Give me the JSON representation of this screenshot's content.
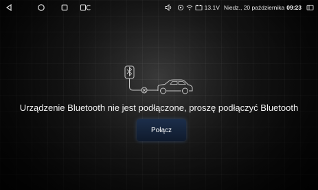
{
  "status_bar": {
    "voltage": "13.1V",
    "date": "Niedz., 20 października",
    "time": "09:23"
  },
  "icons": {
    "back": "back-triangle-icon",
    "home": "home-circle-icon",
    "recents": "recents-square-icon",
    "screen": "screen-toggle-icon",
    "volume": "volume-icon",
    "location": "location-icon",
    "wifi": "wifi-icon",
    "battery": "car-battery-icon",
    "window": "window-icon"
  },
  "main": {
    "message": "Urządzenie Bluetooth nie jest podłączone, proszę podłączyć Bluetooth",
    "connect_label": "Połącz"
  },
  "colors": {
    "button": "#162640",
    "illustration": "#c8c8c8"
  }
}
